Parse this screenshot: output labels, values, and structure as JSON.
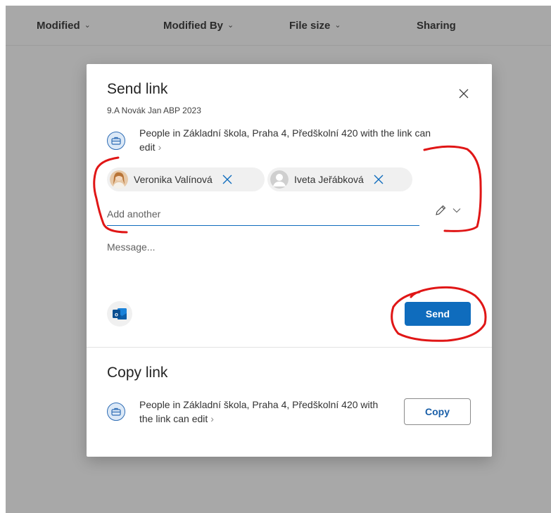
{
  "columns": [
    {
      "label": "Modified",
      "icon": "chevron-down-icon"
    },
    {
      "label": "Modified By",
      "icon": "chevron-down-icon"
    },
    {
      "label": "File size",
      "icon": "chevron-down-icon"
    },
    {
      "label": "Sharing"
    }
  ],
  "dialog": {
    "title": "Send link",
    "subtitle": "9.A Novák Jan ABP 2023",
    "permission_text": "People in Základní škola, Praha 4, Předškolní 420 with the link can edit",
    "recipients": [
      {
        "name": "Veronika Valínová"
      },
      {
        "name": "Iveta Jeřábková"
      }
    ],
    "add_placeholder": "Add another",
    "message_placeholder": "Message...",
    "send_label": "Send",
    "copy_section": {
      "title": "Copy link",
      "permission_text": "People in Základní škola, Praha 4, Předškolní 420 with the link can edit",
      "copy_label": "Copy"
    }
  },
  "colors": {
    "accent": "#0f6cbd",
    "background_overlay": "#a8a8a8",
    "annotation": "#e01616"
  }
}
